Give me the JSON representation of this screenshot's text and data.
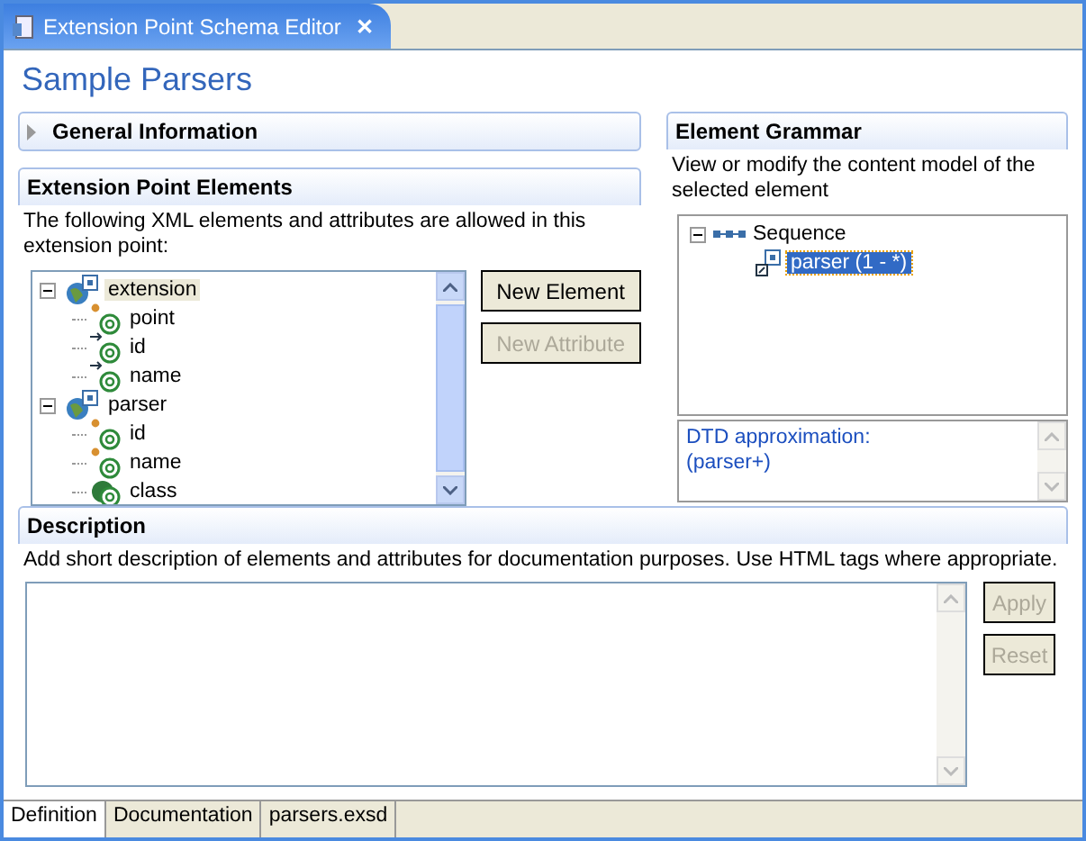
{
  "editor_tab": {
    "title": "Extension Point Schema Editor",
    "close": "✕"
  },
  "page_title": "Sample Parsers",
  "general_section": {
    "title": "General Information",
    "expanded": false
  },
  "elements_section": {
    "title": "Extension Point Elements",
    "description": "The following XML elements and attributes are allowed in this extension point:",
    "tree": [
      {
        "label": "extension",
        "kind": "element",
        "expanded": true,
        "selected": true,
        "children": [
          {
            "label": "point",
            "kind": "required-attribute",
            "selected": false
          },
          {
            "label": "id",
            "kind": "reference-attribute",
            "selected": false
          },
          {
            "label": "name",
            "kind": "reference-attribute",
            "selected": false
          }
        ]
      },
      {
        "label": "parser",
        "kind": "element",
        "expanded": true,
        "selected": false,
        "children": [
          {
            "label": "id",
            "kind": "required-attribute",
            "selected": false
          },
          {
            "label": "name",
            "kind": "required-attribute",
            "selected": false
          },
          {
            "label": "class",
            "kind": "class-attribute",
            "selected": false
          }
        ]
      }
    ],
    "buttons": [
      {
        "label": "New Element",
        "disabled": false
      },
      {
        "label": "New Attribute",
        "disabled": true
      }
    ]
  },
  "grammar_section": {
    "title": "Element Grammar",
    "description": "View or modify the content model of the selected element",
    "tree": [
      {
        "label": "Sequence",
        "expanded": true,
        "selected": false,
        "children": [
          {
            "label": "parser (1 - *)",
            "selected": true
          }
        ]
      }
    ],
    "dtd_label": "DTD approximation:",
    "dtd_value": "(parser+)"
  },
  "description_section": {
    "title": "Description",
    "description": "Add short description of elements and attributes for documentation purposes. Use HTML tags where appropriate.",
    "buttons": [
      {
        "label": "Apply",
        "disabled": true
      },
      {
        "label": "Reset",
        "disabled": true
      }
    ]
  },
  "bottom_tabs": [
    {
      "label": "Definition",
      "selected": true
    },
    {
      "label": "Documentation",
      "selected": false
    },
    {
      "label": "parsers.exsd",
      "selected": false
    }
  ]
}
